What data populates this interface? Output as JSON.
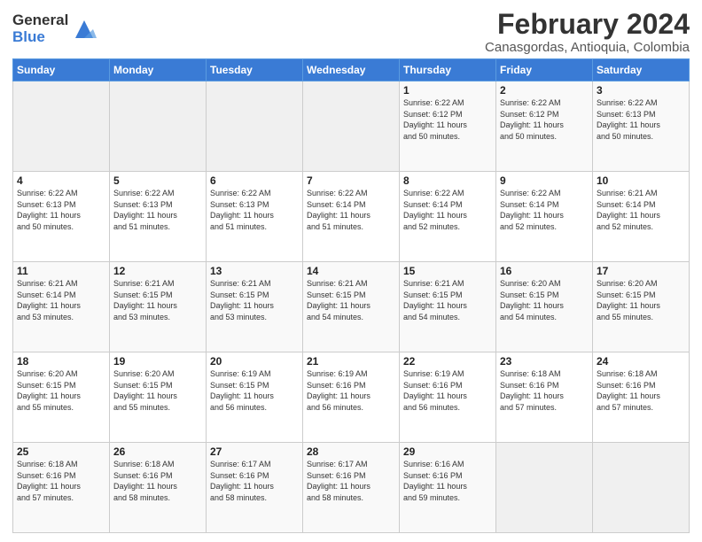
{
  "logo": {
    "general": "General",
    "blue": "Blue"
  },
  "title": "February 2024",
  "subtitle": "Canasgordas, Antioquia, Colombia",
  "days_of_week": [
    "Sunday",
    "Monday",
    "Tuesday",
    "Wednesday",
    "Thursday",
    "Friday",
    "Saturday"
  ],
  "weeks": [
    [
      {
        "day": "",
        "info": ""
      },
      {
        "day": "",
        "info": ""
      },
      {
        "day": "",
        "info": ""
      },
      {
        "day": "",
        "info": ""
      },
      {
        "day": "1",
        "info": "Sunrise: 6:22 AM\nSunset: 6:12 PM\nDaylight: 11 hours\nand 50 minutes."
      },
      {
        "day": "2",
        "info": "Sunrise: 6:22 AM\nSunset: 6:12 PM\nDaylight: 11 hours\nand 50 minutes."
      },
      {
        "day": "3",
        "info": "Sunrise: 6:22 AM\nSunset: 6:13 PM\nDaylight: 11 hours\nand 50 minutes."
      }
    ],
    [
      {
        "day": "4",
        "info": "Sunrise: 6:22 AM\nSunset: 6:13 PM\nDaylight: 11 hours\nand 50 minutes."
      },
      {
        "day": "5",
        "info": "Sunrise: 6:22 AM\nSunset: 6:13 PM\nDaylight: 11 hours\nand 51 minutes."
      },
      {
        "day": "6",
        "info": "Sunrise: 6:22 AM\nSunset: 6:13 PM\nDaylight: 11 hours\nand 51 minutes."
      },
      {
        "day": "7",
        "info": "Sunrise: 6:22 AM\nSunset: 6:14 PM\nDaylight: 11 hours\nand 51 minutes."
      },
      {
        "day": "8",
        "info": "Sunrise: 6:22 AM\nSunset: 6:14 PM\nDaylight: 11 hours\nand 52 minutes."
      },
      {
        "day": "9",
        "info": "Sunrise: 6:22 AM\nSunset: 6:14 PM\nDaylight: 11 hours\nand 52 minutes."
      },
      {
        "day": "10",
        "info": "Sunrise: 6:21 AM\nSunset: 6:14 PM\nDaylight: 11 hours\nand 52 minutes."
      }
    ],
    [
      {
        "day": "11",
        "info": "Sunrise: 6:21 AM\nSunset: 6:14 PM\nDaylight: 11 hours\nand 53 minutes."
      },
      {
        "day": "12",
        "info": "Sunrise: 6:21 AM\nSunset: 6:15 PM\nDaylight: 11 hours\nand 53 minutes."
      },
      {
        "day": "13",
        "info": "Sunrise: 6:21 AM\nSunset: 6:15 PM\nDaylight: 11 hours\nand 53 minutes."
      },
      {
        "day": "14",
        "info": "Sunrise: 6:21 AM\nSunset: 6:15 PM\nDaylight: 11 hours\nand 54 minutes."
      },
      {
        "day": "15",
        "info": "Sunrise: 6:21 AM\nSunset: 6:15 PM\nDaylight: 11 hours\nand 54 minutes."
      },
      {
        "day": "16",
        "info": "Sunrise: 6:20 AM\nSunset: 6:15 PM\nDaylight: 11 hours\nand 54 minutes."
      },
      {
        "day": "17",
        "info": "Sunrise: 6:20 AM\nSunset: 6:15 PM\nDaylight: 11 hours\nand 55 minutes."
      }
    ],
    [
      {
        "day": "18",
        "info": "Sunrise: 6:20 AM\nSunset: 6:15 PM\nDaylight: 11 hours\nand 55 minutes."
      },
      {
        "day": "19",
        "info": "Sunrise: 6:20 AM\nSunset: 6:15 PM\nDaylight: 11 hours\nand 55 minutes."
      },
      {
        "day": "20",
        "info": "Sunrise: 6:19 AM\nSunset: 6:15 PM\nDaylight: 11 hours\nand 56 minutes."
      },
      {
        "day": "21",
        "info": "Sunrise: 6:19 AM\nSunset: 6:16 PM\nDaylight: 11 hours\nand 56 minutes."
      },
      {
        "day": "22",
        "info": "Sunrise: 6:19 AM\nSunset: 6:16 PM\nDaylight: 11 hours\nand 56 minutes."
      },
      {
        "day": "23",
        "info": "Sunrise: 6:18 AM\nSunset: 6:16 PM\nDaylight: 11 hours\nand 57 minutes."
      },
      {
        "day": "24",
        "info": "Sunrise: 6:18 AM\nSunset: 6:16 PM\nDaylight: 11 hours\nand 57 minutes."
      }
    ],
    [
      {
        "day": "25",
        "info": "Sunrise: 6:18 AM\nSunset: 6:16 PM\nDaylight: 11 hours\nand 57 minutes."
      },
      {
        "day": "26",
        "info": "Sunrise: 6:18 AM\nSunset: 6:16 PM\nDaylight: 11 hours\nand 58 minutes."
      },
      {
        "day": "27",
        "info": "Sunrise: 6:17 AM\nSunset: 6:16 PM\nDaylight: 11 hours\nand 58 minutes."
      },
      {
        "day": "28",
        "info": "Sunrise: 6:17 AM\nSunset: 6:16 PM\nDaylight: 11 hours\nand 58 minutes."
      },
      {
        "day": "29",
        "info": "Sunrise: 6:16 AM\nSunset: 6:16 PM\nDaylight: 11 hours\nand 59 minutes."
      },
      {
        "day": "",
        "info": ""
      },
      {
        "day": "",
        "info": ""
      }
    ]
  ]
}
